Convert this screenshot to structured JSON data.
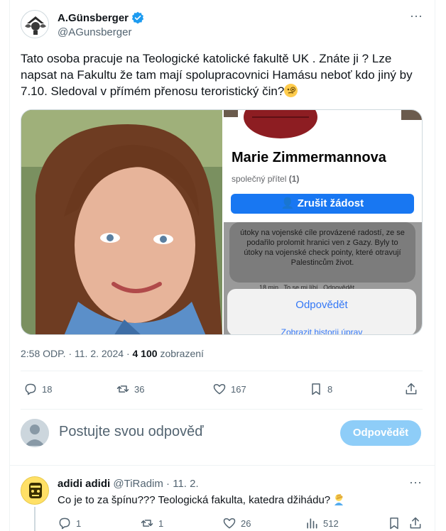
{
  "author": {
    "display_name": "A.Günsberger",
    "handle": "@AGunsberger",
    "verified": true,
    "verified_color": "#1d9bf0"
  },
  "tweet": {
    "text": "Tato osoba pracuje na Teologické katolické fakultě UK . Znáte ji ? Lze napsat na Fakultu že tam mají spolupracovnici Hamásu neboť kdo jiný by 7.10. Sledoval v přímém přenosu teroristický čin?",
    "emoji": "face-with-monocle",
    "time": "2:58 ODP.",
    "date": "11. 2. 2024",
    "views_count": "4 100",
    "views_label": "zobrazení",
    "separator": "·"
  },
  "media": {
    "left_photo": "woman-portrait",
    "screenshot": {
      "profile_name": "Marie Zimmermannova",
      "mutual_label": "společný přítel",
      "mutual_count": "(1)",
      "button_label": "Zrušit žádost",
      "comment_text": "útoky na vojenské cíle provázené radostí, ze se podařilo prolomit hranici ven z Gazy. Byly to útoky na vojenské check pointy, které otravují Palestincům život.",
      "comment_time": "18 min",
      "comment_like": "To se mi líbí",
      "comment_reply": "Odpovědět",
      "sheet_action_1": "Odpovědět",
      "sheet_action_2": "Zobrazit historii úprav"
    }
  },
  "actions": {
    "replies": "18",
    "reposts": "36",
    "likes": "167",
    "bookmarks": "8"
  },
  "reply_box": {
    "placeholder": "Postujte svou odpověď",
    "button_label": "Odpovědět",
    "button_color": "#8ecdf8"
  },
  "reply": {
    "display_name": "adidi adidi",
    "handle": "@TiRadim",
    "date": "11. 2.",
    "separator": "·",
    "text": "Co je to za špínu??? Teologická fakulta, katedra džihádu?",
    "emoji": "person-facepalming",
    "replies": "1",
    "reposts": "1",
    "likes": "26",
    "views": "512"
  },
  "colors": {
    "text_primary": "#0f1419",
    "text_secondary": "#536471",
    "facebook_blue": "#1877f2"
  }
}
